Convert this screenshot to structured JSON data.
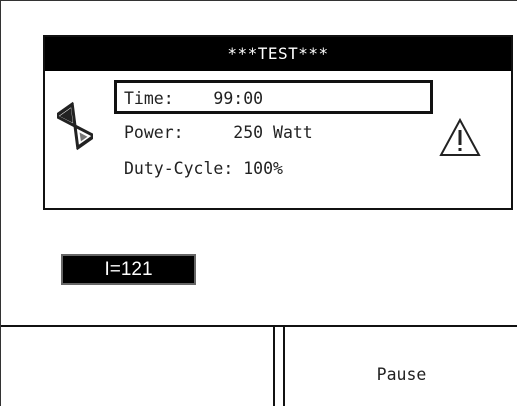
{
  "panel": {
    "title": "***TEST***",
    "rows": {
      "time": "Time:    99:00",
      "power": "Power:     250 Watt",
      "duty": "Duty-Cycle: 100%"
    },
    "icons": {
      "hourglass": "hourglass-icon",
      "warning": "warning-icon"
    }
  },
  "indicator": {
    "label": "I=121"
  },
  "buttons": {
    "left_label": "",
    "right_label": "Pause"
  },
  "colors": {
    "title_bg": "#000000",
    "title_fg": "#ffffff",
    "indicator_bg": "#000000",
    "indicator_fg": "#ffffff",
    "background": "#ffffff"
  }
}
